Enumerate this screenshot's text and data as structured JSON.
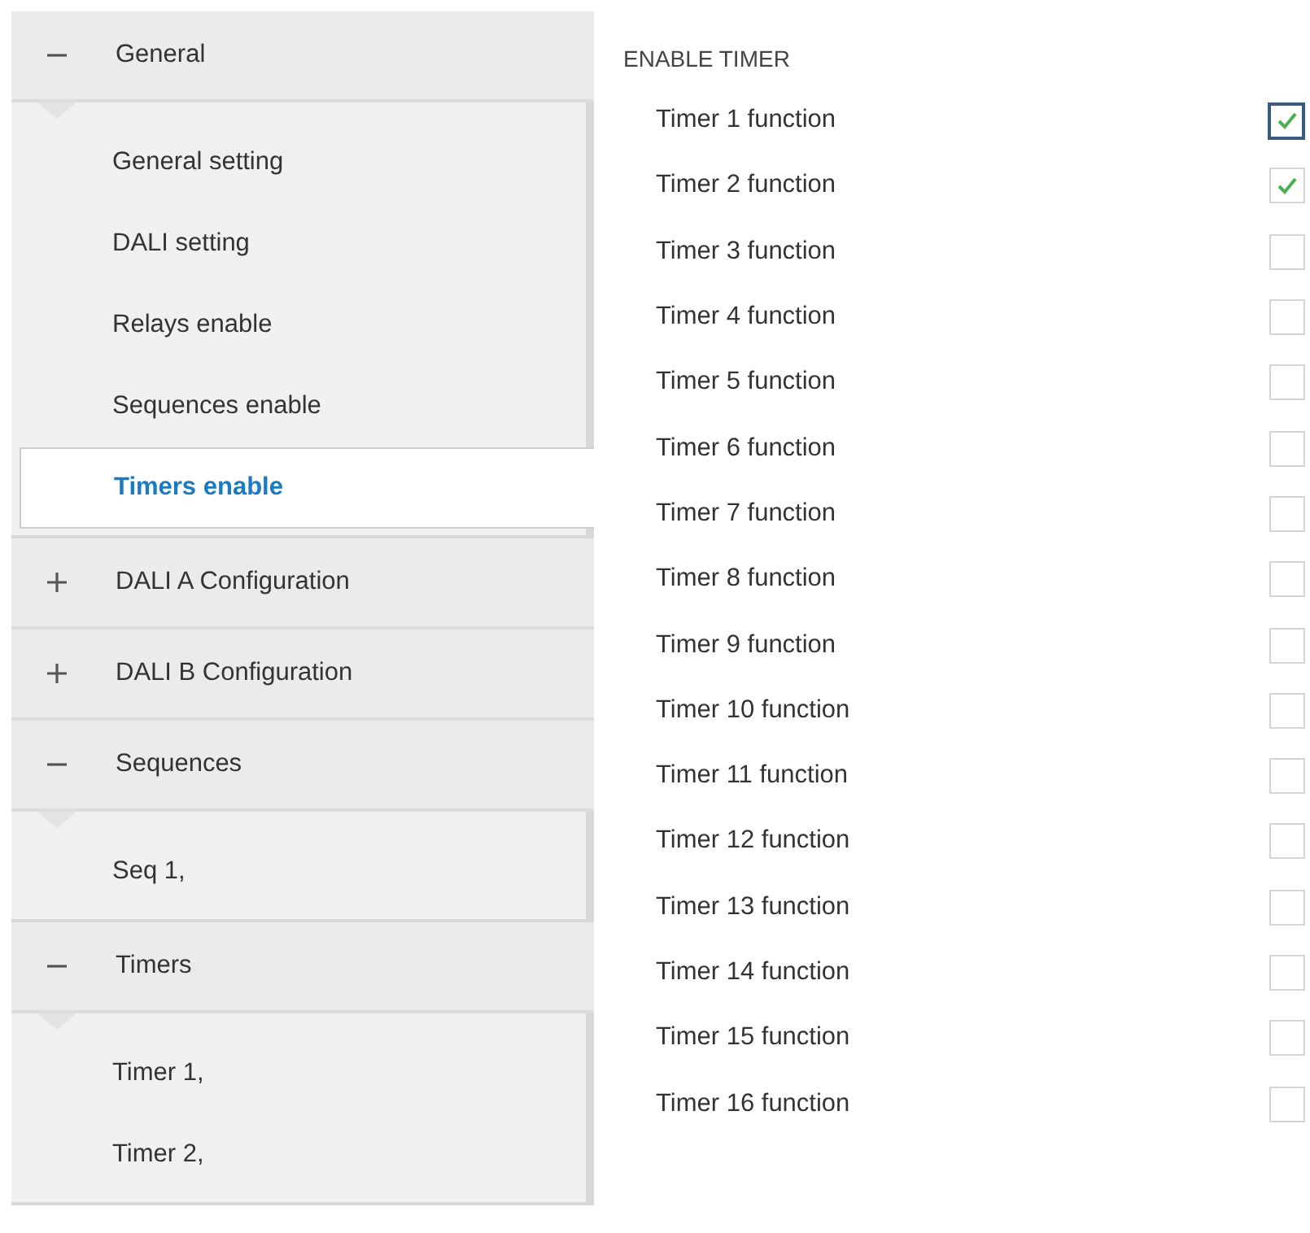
{
  "sidebar": {
    "sections": [
      {
        "label": "General",
        "expanded": true,
        "children": [
          {
            "label": "General setting",
            "selected": false
          },
          {
            "label": "DALI setting",
            "selected": false
          },
          {
            "label": "Relays enable",
            "selected": false
          },
          {
            "label": "Sequences enable",
            "selected": false
          },
          {
            "label": "Timers enable",
            "selected": true
          }
        ]
      },
      {
        "label": "DALI A Configuration",
        "expanded": false
      },
      {
        "label": "DALI B Configuration",
        "expanded": false
      },
      {
        "label": "Sequences",
        "expanded": true,
        "children": [
          {
            "label": "Seq 1,",
            "selected": false
          }
        ]
      },
      {
        "label": "Timers",
        "expanded": true,
        "children": [
          {
            "label": "Timer 1,",
            "selected": false
          },
          {
            "label": "Timer 2,",
            "selected": false
          }
        ]
      }
    ]
  },
  "panel": {
    "title": "ENABLE TIMER",
    "options": [
      {
        "label": "Timer 1 function",
        "checked": true,
        "focused": true
      },
      {
        "label": "Timer 2 function",
        "checked": true,
        "focused": false
      },
      {
        "label": "Timer 3 function",
        "checked": false,
        "focused": false
      },
      {
        "label": "Timer 4 function",
        "checked": false,
        "focused": false
      },
      {
        "label": "Timer 5 function",
        "checked": false,
        "focused": false
      },
      {
        "label": "Timer 6 function",
        "checked": false,
        "focused": false
      },
      {
        "label": "Timer 7 function",
        "checked": false,
        "focused": false
      },
      {
        "label": "Timer 8 function",
        "checked": false,
        "focused": false
      },
      {
        "label": "Timer 9 function",
        "checked": false,
        "focused": false
      },
      {
        "label": "Timer 10 function",
        "checked": false,
        "focused": false
      },
      {
        "label": "Timer 11 function",
        "checked": false,
        "focused": false
      },
      {
        "label": "Timer 12 function",
        "checked": false,
        "focused": false
      },
      {
        "label": "Timer 13 function",
        "checked": false,
        "focused": false
      },
      {
        "label": "Timer 14 function",
        "checked": false,
        "focused": false
      },
      {
        "label": "Timer 15 function",
        "checked": false,
        "focused": false
      },
      {
        "label": "Timer 16 function",
        "checked": false,
        "focused": false
      }
    ]
  }
}
